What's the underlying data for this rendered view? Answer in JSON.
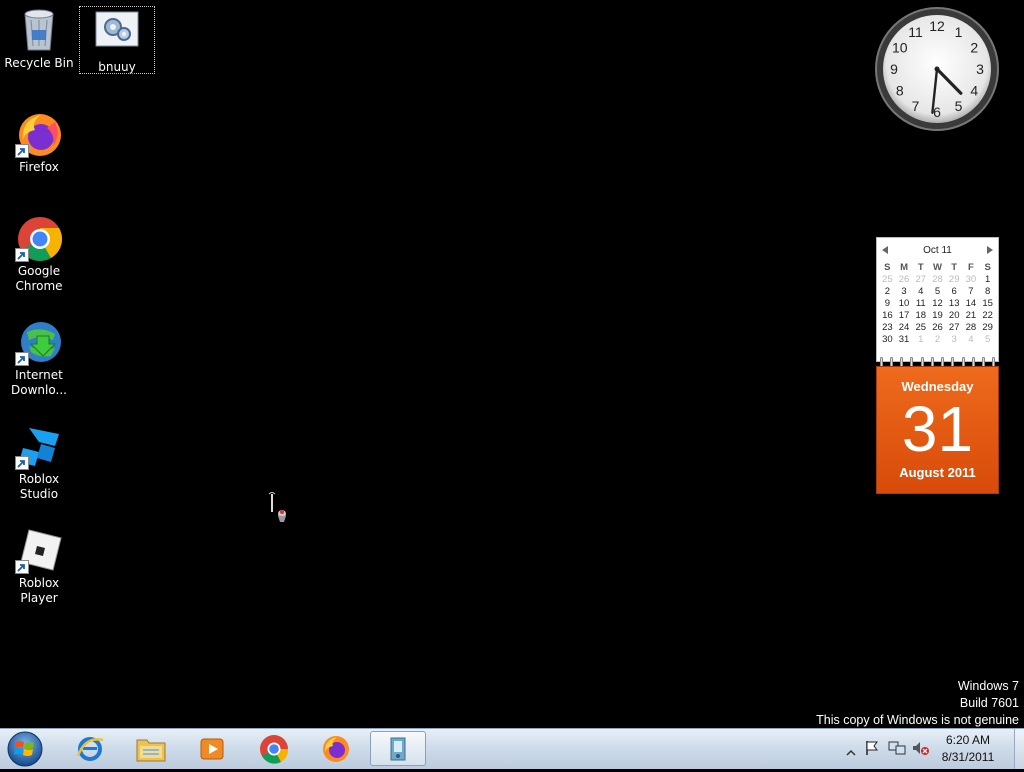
{
  "desktop": {
    "icons": [
      {
        "label": "Recycle Bin"
      },
      {
        "label": "bnuuy"
      },
      {
        "label": "Firefox"
      },
      {
        "label": "Google Chrome"
      },
      {
        "label": "Internet Downlo..."
      },
      {
        "label": "Roblox Studio"
      },
      {
        "label": "Roblox Player"
      }
    ]
  },
  "clock": {
    "time_shown": "4:31",
    "numerals": [
      "12",
      "1",
      "2",
      "3",
      "4",
      "5",
      "6",
      "7",
      "8",
      "9",
      "10",
      "11"
    ]
  },
  "calendar": {
    "month_label": "Oct 11",
    "weekday_headers": [
      "S",
      "M",
      "T",
      "W",
      "T",
      "F",
      "S"
    ],
    "weeks": [
      [
        "25",
        "26",
        "27",
        "28",
        "29",
        "30",
        "1"
      ],
      [
        "2",
        "3",
        "4",
        "5",
        "6",
        "7",
        "8"
      ],
      [
        "9",
        "10",
        "11",
        "12",
        "13",
        "14",
        "15"
      ],
      [
        "16",
        "17",
        "18",
        "19",
        "20",
        "21",
        "22"
      ],
      [
        "23",
        "24",
        "25",
        "26",
        "27",
        "28",
        "29"
      ],
      [
        "30",
        "31",
        "1",
        "2",
        "3",
        "4",
        "5"
      ]
    ],
    "weekday": "Wednesday",
    "day": "31",
    "month_year": "August 2011"
  },
  "watermark": {
    "line1": "Windows 7",
    "line2": "Build 7601",
    "line3": "This copy of Windows is not genuine"
  },
  "taskbar": {
    "pinned": [
      "internet-explorer",
      "windows-explorer",
      "media-player",
      "google-chrome",
      "firefox",
      "active-app"
    ],
    "tray": {
      "time": "6:20 AM",
      "date": "8/31/2011"
    }
  },
  "colors": {
    "calendar_accent": "#e8611a",
    "taskbar": "#cfdcea"
  }
}
